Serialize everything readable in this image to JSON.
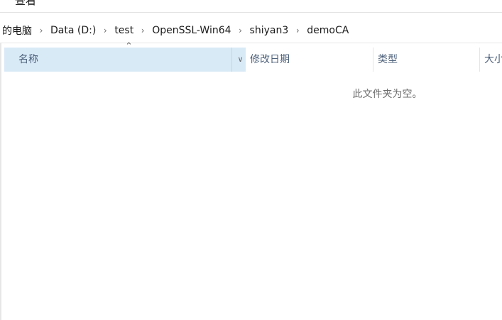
{
  "ribbon": {
    "tab_label": "查看"
  },
  "breadcrumb": {
    "items": [
      {
        "label": "的电脑"
      },
      {
        "label": "Data (D:)"
      },
      {
        "label": "test"
      },
      {
        "label": "OpenSSL-Win64"
      },
      {
        "label": "shiyan3"
      },
      {
        "label": "demoCA"
      }
    ]
  },
  "columns": {
    "name": "名称",
    "date_modified": "修改日期",
    "type": "类型",
    "size": "大小"
  },
  "empty_message": "此文件夹为空。",
  "colors": {
    "selected_header": "#d9eaf7",
    "header_text": "#4c607a"
  }
}
